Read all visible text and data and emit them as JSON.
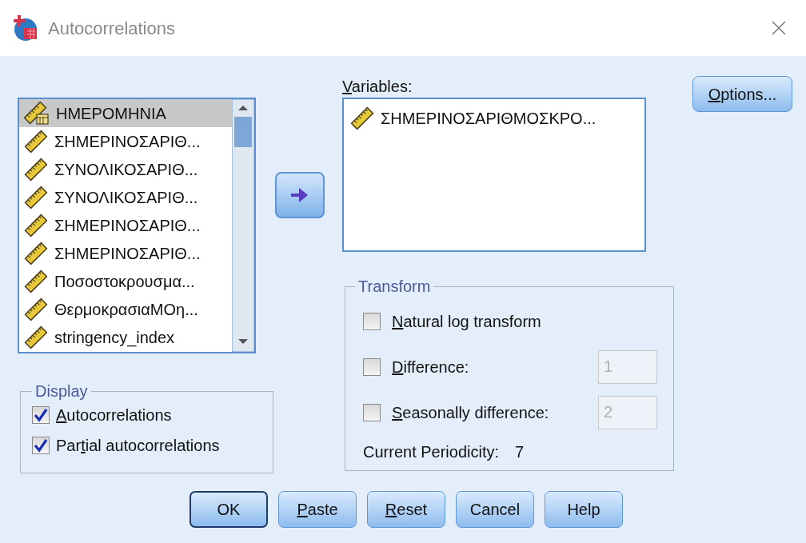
{
  "window": {
    "title": "Autocorrelations"
  },
  "source_list": {
    "items": [
      {
        "name": "ΗΜΕΡΟΜΗΝΙΑ",
        "kind": "date",
        "selected": true
      },
      {
        "name": "ΣΗΜΕΡΙΝΟΣΑΡΙΘ...",
        "kind": "scale",
        "selected": false
      },
      {
        "name": "ΣΥΝΟΛΙΚΟΣΑΡΙΘ...",
        "kind": "scale",
        "selected": false
      },
      {
        "name": "ΣΥΝΟΛΙΚΟΣΑΡΙΘ...",
        "kind": "scale",
        "selected": false
      },
      {
        "name": "ΣΗΜΕΡΙΝΟΣΑΡΙΘ...",
        "kind": "scale",
        "selected": false
      },
      {
        "name": "ΣΗΜΕΡΙΝΟΣΑΡΙΘ...",
        "kind": "scale",
        "selected": false
      },
      {
        "name": "Ποσοστοκρουσμα...",
        "kind": "scale",
        "selected": false
      },
      {
        "name": "ΘερμοκρασιαΜΟη...",
        "kind": "scale",
        "selected": false
      },
      {
        "name": "stringency_index",
        "kind": "scale",
        "selected": false
      }
    ]
  },
  "variables": {
    "label": {
      "key": "V",
      "after": "ariables:"
    },
    "items": [
      {
        "name": "ΣΗΜΕΡΙΝΟΣΑΡΙΘΜΟΣΚΡΟ...",
        "kind": "scale",
        "selected": false
      }
    ]
  },
  "options_button": {
    "key": "O",
    "after": "ptions..."
  },
  "display": {
    "title": "Display",
    "options": [
      {
        "label": {
          "key": "A",
          "after": "utocorrelations"
        },
        "checked": true
      },
      {
        "label": {
          "before": "Par",
          "key": "t",
          "after": "ial autocorrelations"
        },
        "checked": true
      }
    ]
  },
  "transform": {
    "title": "Transform",
    "options": [
      {
        "kind": "checkbox",
        "label": {
          "key": "N",
          "after": "atural log transform"
        },
        "checked": false
      },
      {
        "kind": "checkbox_field",
        "label": {
          "key": "D",
          "after": "ifference:"
        },
        "checked": false,
        "value": "1",
        "disabled": true
      },
      {
        "kind": "checkbox_field",
        "label": {
          "key": "S",
          "after": "easonally difference:"
        },
        "checked": false,
        "value": "2",
        "disabled": true
      }
    ],
    "periodicity_label": "Current Periodicity:",
    "periodicity_value": "7"
  },
  "buttons": [
    {
      "label": {
        "before": "OK"
      },
      "default": true
    },
    {
      "label": {
        "key": "P",
        "after": "aste"
      },
      "default": false
    },
    {
      "label": {
        "key": "R",
        "after": "eset"
      },
      "default": false
    },
    {
      "label": {
        "before": "Cancel"
      },
      "default": false
    },
    {
      "label": {
        "before": "Help"
      },
      "default": false
    }
  ]
}
